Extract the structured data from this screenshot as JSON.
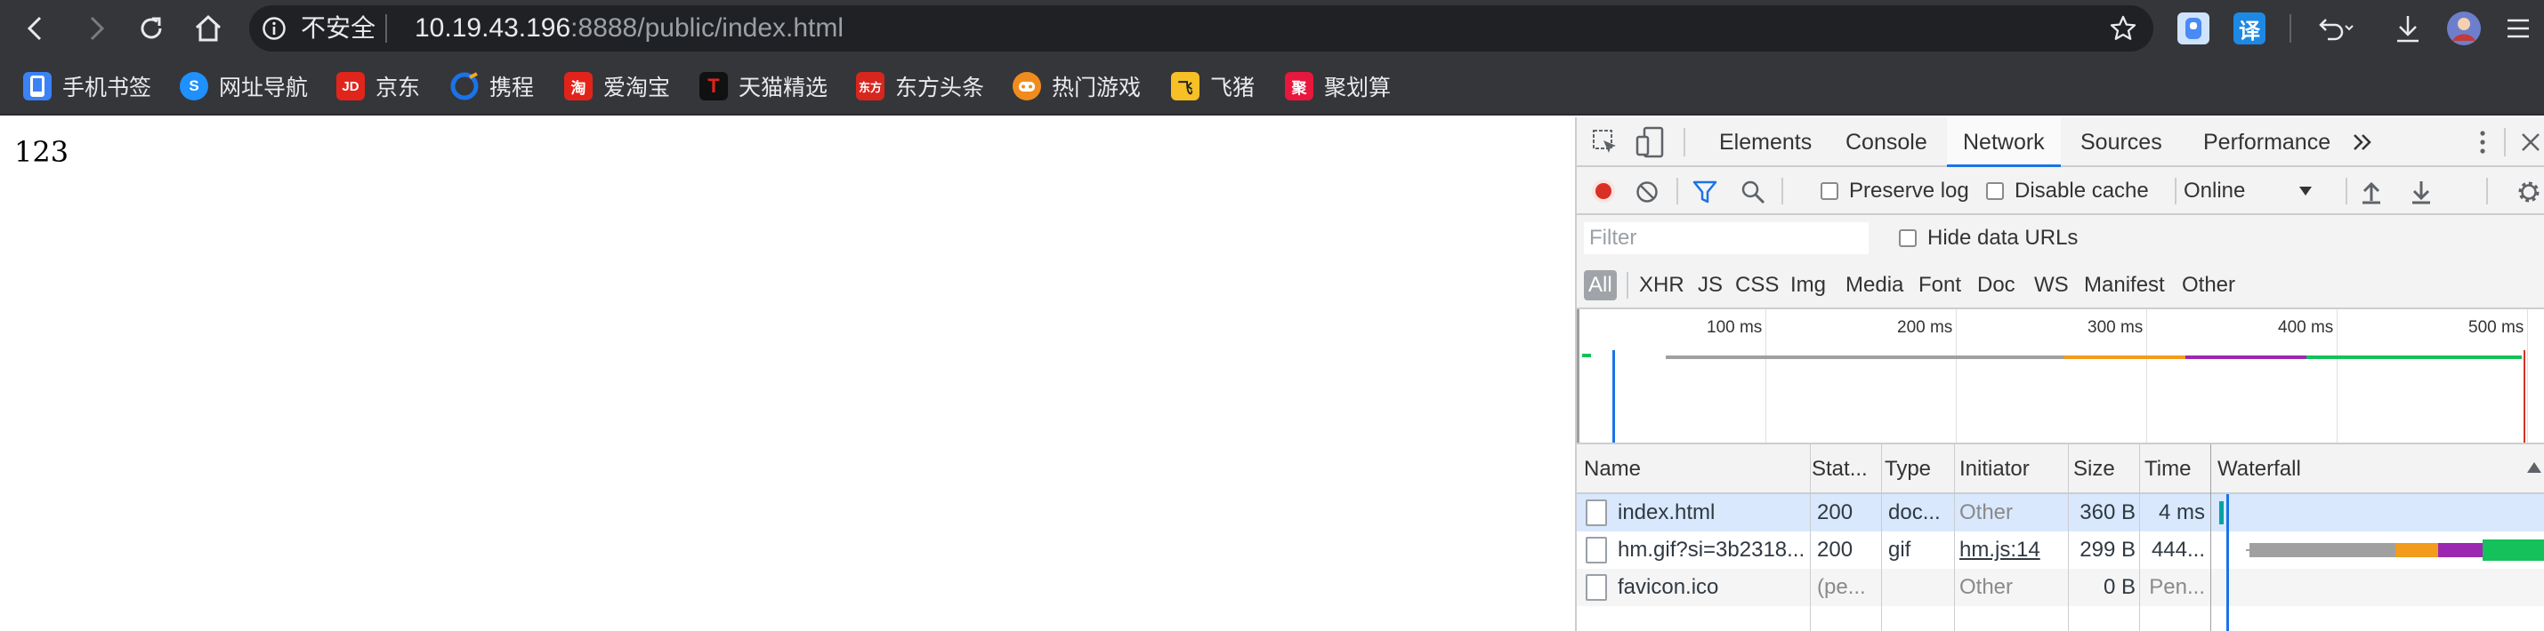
{
  "browser": {
    "security_label": "不安全",
    "url_host": "10.19.43.196",
    "url_rest": ":8888/public/index.html",
    "ext_translate_label": "译"
  },
  "bookmarks": [
    {
      "label": "手机书签",
      "icon": "phone-bookmark-icon",
      "color": "#3b82f6",
      "glyph": ""
    },
    {
      "label": "网址导航",
      "icon": "site-nav-icon",
      "color": "#1e90ff",
      "glyph": "S"
    },
    {
      "label": "京东",
      "icon": "jd-icon",
      "color": "#e1251b",
      "glyph": "JD"
    },
    {
      "label": "携程",
      "icon": "ctrip-icon",
      "color": "#1a73e8",
      "glyph": ""
    },
    {
      "label": "爱淘宝",
      "icon": "ai-taobao-icon",
      "color": "#e2231a",
      "glyph": "淘"
    },
    {
      "label": "天猫精选",
      "icon": "tmall-icon",
      "color": "#d81e06",
      "glyph": "T"
    },
    {
      "label": "东方头条",
      "icon": "dftt-icon",
      "color": "#d7261e",
      "glyph": "东方"
    },
    {
      "label": "热门游戏",
      "icon": "hot-games-icon",
      "color": "#f08c1e",
      "glyph": ""
    },
    {
      "label": "飞猪",
      "icon": "fliggy-icon",
      "color": "#f6c026",
      "glyph": "飞"
    },
    {
      "label": "聚划算",
      "icon": "juhuasuan-icon",
      "color": "#e8173d",
      "glyph": "聚"
    }
  ],
  "page": {
    "content": "123"
  },
  "devtools": {
    "tabs": [
      "Elements",
      "Console",
      "Network",
      "Sources",
      "Performance"
    ],
    "active_tab": "Network",
    "preserve_log": "Preserve log",
    "disable_cache": "Disable cache",
    "throttle": "Online",
    "filter_placeholder": "Filter",
    "hide_data_urls": "Hide data URLs",
    "types": [
      "All",
      "XHR",
      "JS",
      "CSS",
      "Img",
      "Media",
      "Font",
      "Doc",
      "WS",
      "Manifest",
      "Other"
    ],
    "active_type": "All",
    "timeline_ticks": [
      "100 ms",
      "200 ms",
      "300 ms",
      "400 ms",
      "500 ms"
    ],
    "columns": [
      "Name",
      "Stat...",
      "Type",
      "Initiator",
      "Size",
      "Time",
      "Waterfall"
    ],
    "requests": [
      {
        "name": "index.html",
        "status": "200",
        "type": "doc...",
        "initiator": "Other",
        "size": "360 B",
        "time": "4 ms"
      },
      {
        "name": "hm.gif?si=3b2318...",
        "status": "200",
        "type": "gif",
        "initiator": "hm.js:14",
        "size": "299 B",
        "time": "444..."
      },
      {
        "name": "favicon.ico",
        "status": "(pe...",
        "type": "",
        "initiator": "Other",
        "size": "0 B",
        "time": "Pen..."
      }
    ]
  },
  "colors": {
    "toolbar_bg": "#35363a",
    "accent": "#1a73e8",
    "record_red": "#d93025",
    "wf_waiting": "#a0a0a0",
    "wf_orange": "#f29b1d",
    "wf_purple": "#9c27b0",
    "wf_green": "#14c15a"
  }
}
